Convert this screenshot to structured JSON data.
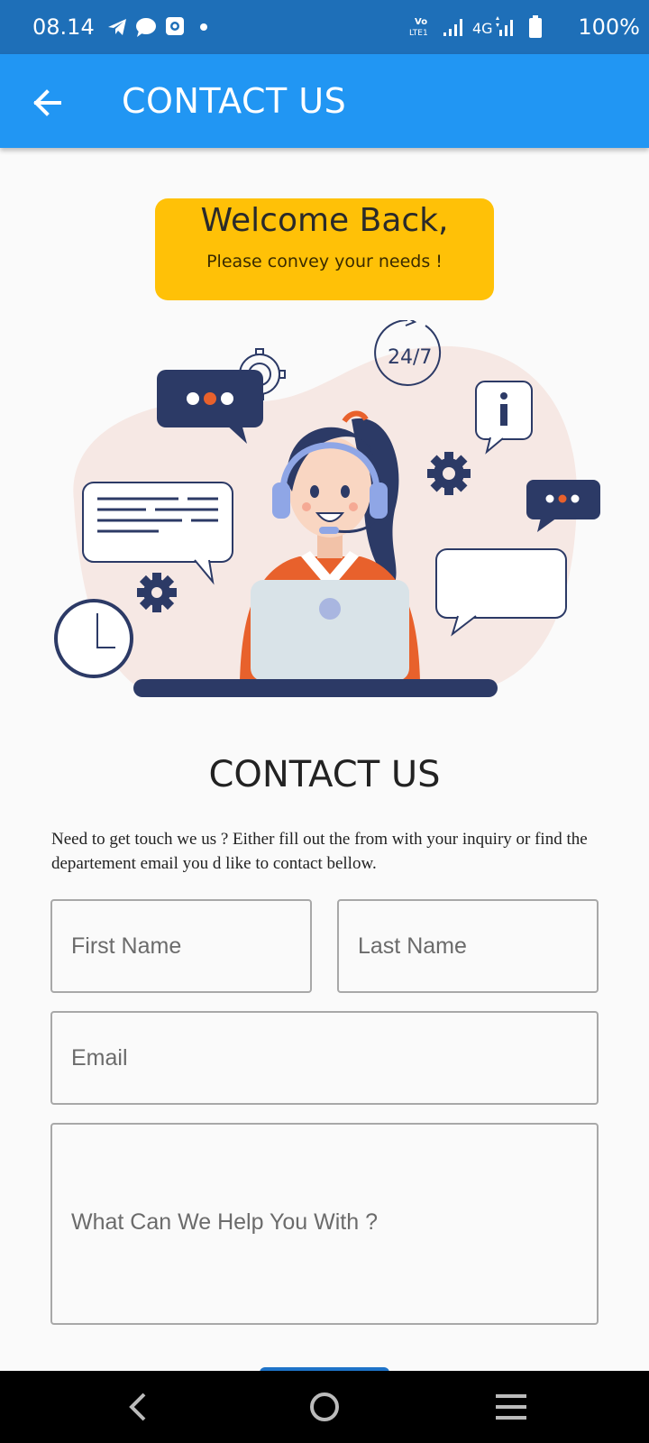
{
  "status_bar": {
    "time": "08.14",
    "battery": "100%",
    "network": "4G",
    "volte": "LTE1",
    "left_icons": [
      "telegram-icon",
      "chat-bubble-icon",
      "camera-box-icon",
      "dot-icon"
    ],
    "right_icons": [
      "volte-icon",
      "signal-icon",
      "battery-icon"
    ]
  },
  "app_bar": {
    "title": "CONTACT US",
    "back_icon": "arrow-left-icon",
    "color": "#2196f3"
  },
  "welcome": {
    "title": "Welcome Back,",
    "subtitle": "Please convey your needs !",
    "color": "#ffc107"
  },
  "illustration": {
    "clock_label": "24/7"
  },
  "section": {
    "title": "CONTACT US",
    "description": "Need to get touch we us ? Either fill out the from with your inquiry or find the departement email you d like to contact bellow."
  },
  "form": {
    "first_name_placeholder": "First Name",
    "last_name_placeholder": "Last Name",
    "email_placeholder": "Email",
    "message_placeholder": "What Can We Help You With ?"
  },
  "nav_bar": {
    "icons": [
      "back-chevron-icon",
      "home-circle-icon",
      "menu-lines-icon"
    ]
  }
}
